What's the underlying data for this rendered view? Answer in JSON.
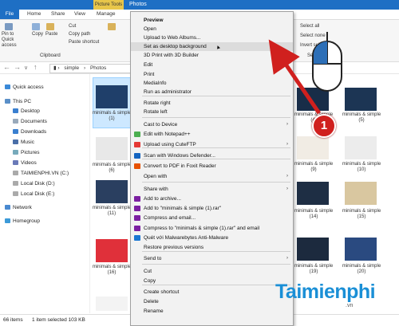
{
  "window": {
    "picture_tools": "Picture Tools",
    "title": "Photos",
    "tabs": [
      "File",
      "Home",
      "Share",
      "View",
      "Manage"
    ]
  },
  "ribbon": {
    "pin_quick_access": "Pin to Quick access",
    "copy": "Copy",
    "paste": "Paste",
    "cut": "Cut",
    "copy_path": "Copy path",
    "paste_shortcut": "Paste shortcut",
    "clipboard_group": "Clipboard",
    "select_all": "Select all",
    "select_none": "Select none",
    "invert_selection": "Invert selection",
    "select_group": "Select"
  },
  "address": {
    "path": [
      "simple",
      "Photos"
    ]
  },
  "sidebar": {
    "items": [
      {
        "label": "Quick access",
        "icon": "star-icon"
      },
      {
        "label": "This PC",
        "icon": "pc-icon"
      },
      {
        "label": "Desktop",
        "icon": "folder-icon"
      },
      {
        "label": "Documents",
        "icon": "folder-icon"
      },
      {
        "label": "Downloads",
        "icon": "download-icon"
      },
      {
        "label": "Music",
        "icon": "music-icon"
      },
      {
        "label": "Pictures",
        "icon": "folder-icon"
      },
      {
        "label": "Videos",
        "icon": "folder-icon"
      },
      {
        "label": "TAIMIENPHI.VN (C:)",
        "icon": "drive-icon"
      },
      {
        "label": "Local Disk (D:)",
        "icon": "drive-icon"
      },
      {
        "label": "Local Disk (E:)",
        "icon": "drive-icon"
      },
      {
        "label": "Network",
        "icon": "network-icon"
      },
      {
        "label": "Homegroup",
        "icon": "homegroup-icon"
      }
    ]
  },
  "files": {
    "left": [
      "minimals & simple (1)",
      "minimals & simple (6)",
      "minimals & simple (11)",
      "minimals & simple (16)",
      "minimals & simple (21)"
    ],
    "right": [
      "minimals & simple (4)",
      "minimals & simple (5)",
      "minimals & simple (9)",
      "minimals & simple (10)",
      "minimals & simple (14)",
      "minimals & simple (15)",
      "minimals & simple (19)",
      "minimals & simple (20)"
    ]
  },
  "context_menu": {
    "items": [
      {
        "label": "Preview",
        "bold": true
      },
      {
        "label": "Open"
      },
      {
        "label": "Upload to Web Albums..."
      },
      {
        "label": "Set as desktop background",
        "highlight": true
      },
      {
        "label": "3D Print with 3D Builder"
      },
      {
        "label": "Edit"
      },
      {
        "label": "Print"
      },
      {
        "label": "MediaInfo"
      },
      {
        "label": "Run as administrator"
      },
      {
        "label": "Rotate right"
      },
      {
        "label": "Rotate left"
      },
      {
        "label": "Cast to Device",
        "submenu": true
      },
      {
        "label": "Edit with Notepad++",
        "icon": "notepad-icon"
      },
      {
        "label": "Upload using CuteFTP",
        "icon": "cuteftp-icon",
        "submenu": true
      },
      {
        "label": "Scan with Windows Defender...",
        "icon": "defender-icon"
      },
      {
        "label": "Convert to PDF in Foxit Reader",
        "icon": "foxit-icon"
      },
      {
        "label": "Open with",
        "submenu": true
      },
      {
        "label": "Share with",
        "submenu": true
      },
      {
        "label": "Add to archive...",
        "icon": "winrar-icon"
      },
      {
        "label": "Add to \"minimals & simple (1).rar\"",
        "icon": "winrar-icon"
      },
      {
        "label": "Compress and email...",
        "icon": "winrar-icon"
      },
      {
        "label": "Compress to \"minimals & simple (1).rar\" and email",
        "icon": "winrar-icon"
      },
      {
        "label": "Quét với Malwarebytes Anti-Malware",
        "icon": "malwarebytes-icon"
      },
      {
        "label": "Restore previous versions"
      },
      {
        "label": "Send to",
        "submenu": true
      },
      {
        "label": "Cut"
      },
      {
        "label": "Copy"
      },
      {
        "label": "Create shortcut"
      },
      {
        "label": "Delete"
      },
      {
        "label": "Rename"
      }
    ]
  },
  "status": {
    "count": "66 items",
    "selection": "1 item selected  103 KB"
  },
  "annotation": {
    "badge": "1"
  },
  "watermark": {
    "brand": "Taimienphi",
    "domain": ".vn"
  },
  "colors": {
    "accent": "#1e6fc4",
    "highlight": "#dcdcdc",
    "badge": "#d0201e",
    "watermark": "#1a8fd6"
  }
}
